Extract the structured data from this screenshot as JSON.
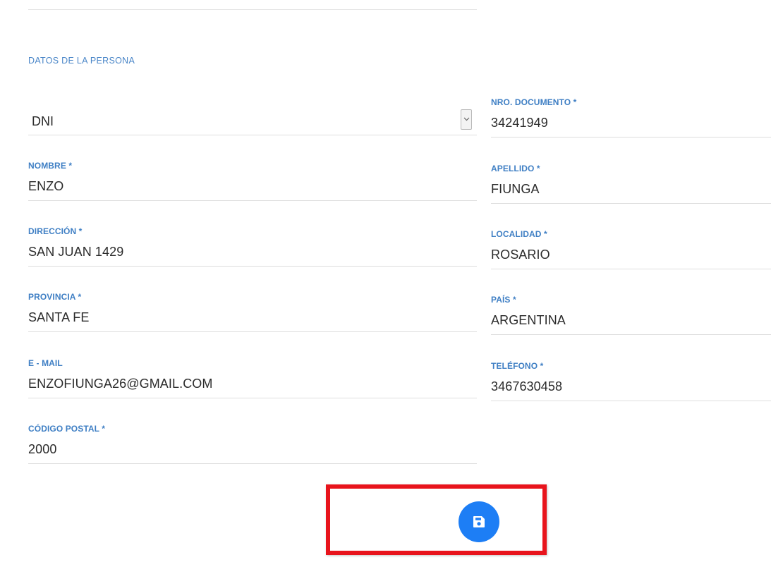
{
  "section": {
    "title": "DATOS DE LA PERSONA"
  },
  "tipo_documento": {
    "selected": "DNI",
    "icon": "chevron-down-icon"
  },
  "fields": {
    "nro_documento": {
      "label": "NRO. DOCUMENTO *",
      "value": "34241949"
    },
    "nombre": {
      "label": "NOMBRE *",
      "value": "ENZO"
    },
    "apellido": {
      "label": "APELLIDO *",
      "value": "FIUNGA"
    },
    "direccion": {
      "label": "DIRECCIÓN *",
      "value": "SAN JUAN 1429"
    },
    "localidad": {
      "label": "LOCALIDAD *",
      "value": "ROSARIO"
    },
    "provincia": {
      "label": "PROVINCIA *",
      "value": "SANTA FE"
    },
    "pais": {
      "label": "PAÍS *",
      "value": "ARGENTINA"
    },
    "email": {
      "label": "E - MAIL",
      "value": "ENZOFIUNGA26@GMAIL.COM"
    },
    "telefono": {
      "label": "TELÉFONO *",
      "value": "3467630458"
    },
    "codigo_postal": {
      "label": "CÓDIGO POSTAL *",
      "value": "2000"
    }
  },
  "save_button": {
    "icon": "floppy-disk-icon",
    "color": "#1d7ef5"
  },
  "highlight": {
    "color": "#e8141c"
  },
  "colors": {
    "label": "#3f7fc4",
    "section_title": "#4a86c8",
    "value": "#2b2b2b",
    "divider": "#dedede"
  }
}
